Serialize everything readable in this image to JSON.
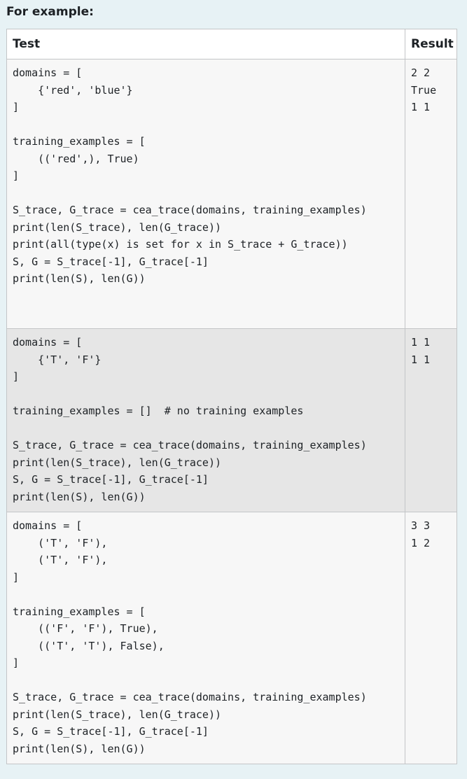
{
  "heading": "For example:",
  "table": {
    "columns": [
      "Test",
      "Result"
    ],
    "rows": [
      {
        "test": "domains = [\n    {'red', 'blue'}\n]\n\ntraining_examples = [\n    (('red',), True)\n]\n\nS_trace, G_trace = cea_trace(domains, training_examples)\nprint(len(S_trace), len(G_trace))\nprint(all(type(x) is set for x in S_trace + G_trace))\nS, G = S_trace[-1], G_trace[-1]\nprint(len(S), len(G))",
        "result": "2 2\nTrue\n1 1"
      },
      {
        "test": "domains = [\n    {'T', 'F'}\n]\n\ntraining_examples = []  # no training examples\n\nS_trace, G_trace = cea_trace(domains, training_examples)\nprint(len(S_trace), len(G_trace))\nS, G = S_trace[-1], G_trace[-1]\nprint(len(S), len(G))",
        "result": "1 1\n1 1"
      },
      {
        "test": "domains = [\n    ('T', 'F'),\n    ('T', 'F'),\n]\n\ntraining_examples = [\n    (('F', 'F'), True),\n    (('T', 'T'), False),\n]\n\nS_trace, G_trace = cea_trace(domains, training_examples)\nprint(len(S_trace), len(G_trace))\nS, G = S_trace[-1], G_trace[-1]\nprint(len(S), len(G))",
        "result": "3 3\n1 2"
      }
    ]
  }
}
